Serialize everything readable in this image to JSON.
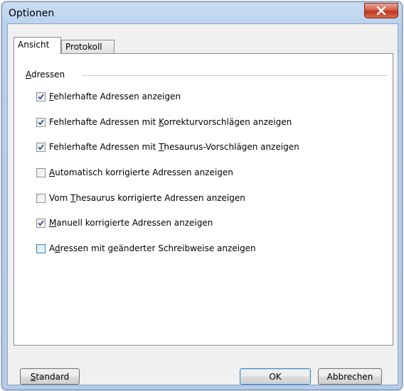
{
  "window": {
    "title": "Optionen"
  },
  "tabs": [
    {
      "label": "Ansicht",
      "active": true
    },
    {
      "label": "Protokoll",
      "active": false
    }
  ],
  "group": {
    "label_prefix": "",
    "label_mnemonic": "A",
    "label_rest": "dressen"
  },
  "options": [
    {
      "pre": "",
      "mn": "F",
      "post": "ehlerhafte Adressen anzeigen",
      "checked": true
    },
    {
      "pre": "Fehlerhafte Adressen mit ",
      "mn": "K",
      "post": "orrekturvorschlägen anzeigen",
      "checked": true
    },
    {
      "pre": "Fehlerhafte Adressen mit ",
      "mn": "T",
      "post": "hesaurus-Vorschlägen anzeigen",
      "checked": true
    },
    {
      "pre": "",
      "mn": "A",
      "post": "utomatisch korrigierte Adressen anzeigen",
      "checked": false
    },
    {
      "pre": "Vom ",
      "mn": "T",
      "post": "hesaurus korrigierte Adressen anzeigen",
      "checked": false
    },
    {
      "pre": "",
      "mn": "M",
      "post": "anuell korrigierte Adressen anzeigen",
      "checked": true
    },
    {
      "pre": "A",
      "mn": "d",
      "post": "ressen mit geänderter Schreibweise anzeigen",
      "checked": false
    }
  ],
  "buttons": {
    "standard": {
      "mn": "S",
      "rest": "tandard"
    },
    "ok": "OK",
    "cancel": "Abbrechen"
  },
  "colors": {
    "close_button": "#c2331e",
    "check": "#2a4f8a"
  }
}
